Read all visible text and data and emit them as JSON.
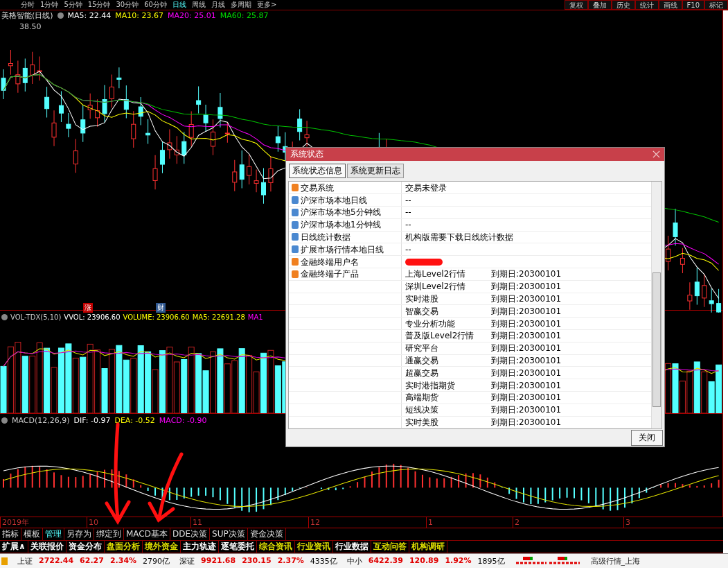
{
  "toolbar": {
    "periods": [
      {
        "label": "分时",
        "selected": false
      },
      {
        "label": "1分钟",
        "selected": false
      },
      {
        "label": "5分钟",
        "selected": false
      },
      {
        "label": "15分钟",
        "selected": false
      },
      {
        "label": "30分钟",
        "selected": false
      },
      {
        "label": "60分钟",
        "selected": false
      },
      {
        "label": "日线",
        "selected": true
      },
      {
        "label": "周线",
        "selected": false
      },
      {
        "label": "月线",
        "selected": false
      },
      {
        "label": "多周期",
        "selected": false
      },
      {
        "label": "更多>",
        "selected": false
      }
    ],
    "tools": [
      "复权",
      "叠加",
      "历史",
      "统计",
      "画线",
      "F10",
      "标记"
    ]
  },
  "main_chart": {
    "title": "美格智能(日线)",
    "lines": [
      {
        "label": "MA5: 22.44",
        "color": "#ffffff"
      },
      {
        "label": "MA10: 23.67",
        "color": "#ffff00"
      },
      {
        "label": "MA20: 25.01",
        "color": "#ff00ff"
      },
      {
        "label": "MA60: 25.87",
        "color": "#00e000"
      }
    ],
    "high_label": "38.50",
    "event_marks": [
      {
        "label": "涨",
        "color": "#c00000"
      },
      {
        "label": "财",
        "color": "#305890"
      }
    ]
  },
  "volume_chart": {
    "indicator": "VOL-TDX(5,10)",
    "lines": [
      {
        "label": "VVOL: 23906.60",
        "color": "#ffffff"
      },
      {
        "label": "VOLUME: 23906.60",
        "color": "#ffff00"
      },
      {
        "label": "MA5: 22691.28",
        "color": "#ffff00"
      },
      {
        "label": "MA1",
        "color": "#ff00ff"
      }
    ]
  },
  "macd_chart": {
    "indicator": "MACD(12,26,9)",
    "lines": [
      {
        "label": "DIF: -0.97",
        "color": "#ffffff"
      },
      {
        "label": "DEA: -0.52",
        "color": "#ffff00"
      },
      {
        "label": "MACD: -0.90",
        "color": "#ff00ff"
      }
    ]
  },
  "time_axis": [
    "2019年",
    "10",
    "11",
    "12",
    "1",
    "2",
    "3"
  ],
  "function_tabs": [
    {
      "label": "指标",
      "selected": false
    },
    {
      "label": "模板",
      "selected": false
    },
    {
      "label": "管理",
      "selected": true
    },
    {
      "label": "另存为",
      "selected": false
    },
    {
      "label": "绑定到",
      "selected": false
    },
    {
      "label": "MACD基本",
      "selected": false
    },
    {
      "label": "DDE决策",
      "selected": false
    },
    {
      "label": "SUP决策",
      "selected": false
    },
    {
      "label": "资金决策",
      "selected": false
    }
  ],
  "info_tabs": [
    {
      "label": "扩展∧",
      "color": "#ffffff"
    },
    {
      "label": "关联报价",
      "color": "#ffffff"
    },
    {
      "label": "资金分布",
      "color": "#ffffff"
    },
    {
      "label": "盘面分析",
      "color": "#e0e000"
    },
    {
      "label": "境外资金",
      "color": "#e0e000"
    },
    {
      "label": "主力轨迹",
      "color": "#ffffff"
    },
    {
      "label": "逐笔委托",
      "color": "#ffffff"
    },
    {
      "label": "综合资讯",
      "color": "#e0e000"
    },
    {
      "label": "行业资讯",
      "color": "#e0e000"
    },
    {
      "label": "行业数据",
      "color": "#ffffff"
    },
    {
      "label": "互动问答",
      "color": "#e0e000"
    },
    {
      "label": "机构调研",
      "color": "#e0e000"
    }
  ],
  "status_bar": {
    "indices": [
      {
        "name": "上证",
        "value": "2722.44",
        "change": "62.27",
        "percent": "2.34%",
        "amount": "2790亿"
      },
      {
        "name": "深证",
        "value": "9921.68",
        "change": "230.15",
        "percent": "2.37%",
        "amount": "4335亿"
      },
      {
        "name": "中小",
        "value": "6422.39",
        "change": "120.89",
        "percent": "1.92%",
        "amount": "1895亿"
      }
    ],
    "feed": "高级行情_上海"
  },
  "dialog": {
    "title": "系统状态",
    "tabs": [
      {
        "label": "系统状态信息",
        "selected": true
      },
      {
        "label": "系统更新日志",
        "selected": false
      }
    ],
    "items": [
      {
        "kind": "warning",
        "name": "交易系统",
        "value": "交易未登录",
        "redacted": false
      },
      {
        "kind": "info",
        "name": "沪深市场本地日线",
        "value": "--",
        "redacted": false
      },
      {
        "kind": "info",
        "name": "沪深市场本地5分钟线",
        "value": "--",
        "redacted": false
      },
      {
        "kind": "info",
        "name": "沪深市场本地1分钟线",
        "value": "--",
        "redacted": false
      },
      {
        "kind": "info",
        "name": "日线统计数据",
        "value": "机构版需要下载日线统计数据",
        "redacted": false
      },
      {
        "kind": "info",
        "name": "扩展市场行情本地日线",
        "value": "--",
        "redacted": false
      },
      {
        "kind": "warning",
        "name": "金融终端用户名",
        "redacted": true
      },
      {
        "kind": "warning",
        "name": "金融终端子产品",
        "redacted": false
      }
    ],
    "products": [
      {
        "name": "上海Level2行情",
        "expiry": "到期日:20300101"
      },
      {
        "name": "深圳Level2行情",
        "expiry": "到期日:20300101"
      },
      {
        "name": "实时港股",
        "expiry": "到期日:20300101"
      },
      {
        "name": "智赢交易",
        "expiry": "到期日:20300101"
      },
      {
        "name": "专业分析功能",
        "expiry": "到期日:20300101"
      },
      {
        "name": "普及版Level2行情",
        "expiry": "到期日:20300101"
      },
      {
        "name": "研究平台",
        "expiry": "到期日:20300101"
      },
      {
        "name": "通赢交易",
        "expiry": "到期日:20300101"
      },
      {
        "name": "超赢交易",
        "expiry": "到期日:20300101"
      },
      {
        "name": "实时港指期货",
        "expiry": "到期日:20300101"
      },
      {
        "name": "高端期货",
        "expiry": "到期日:20300101"
      },
      {
        "name": "短线决策",
        "expiry": "到期日:20300101"
      },
      {
        "name": "实时美股",
        "expiry": "到期日:20300101"
      }
    ],
    "close_button": "关闭"
  }
}
